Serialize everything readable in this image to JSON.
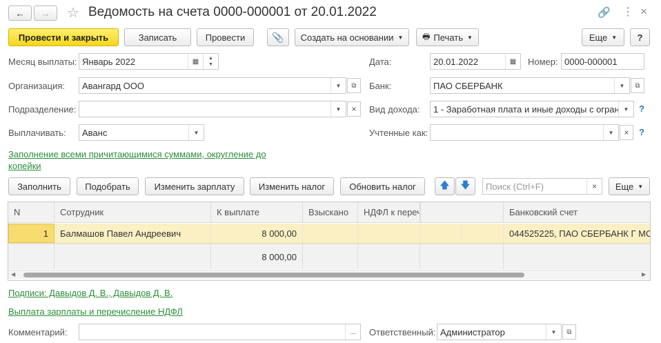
{
  "window": {
    "title": "Ведомость на счета 0000-000001 от 20.01.2022"
  },
  "toolbar": {
    "post_close": "Провести и закрыть",
    "save": "Записать",
    "post": "Провести",
    "create_based": "Создать на основании",
    "print": "Печать",
    "more": "Еще",
    "help": "?"
  },
  "form": {
    "month_label": "Месяц выплаты:",
    "month_value": "Январь 2022",
    "date_label": "Дата:",
    "date_value": "20.01.2022",
    "number_label": "Номер:",
    "number_value": "0000-000001",
    "org_label": "Организация:",
    "org_value": "Авангард ООО",
    "bank_label": "Банк:",
    "bank_value": "ПАО СБЕРБАНК",
    "dept_label": "Подразделение:",
    "dept_value": "",
    "income_label": "Вид дохода:",
    "income_value": "1 - Заработная плата и иные доходы с огран",
    "pay_label": "Выплачивать:",
    "pay_value": "Аванс",
    "counted_label": "Учтенные как:",
    "counted_value": "",
    "fill_link_line1": "Заполнение всеми причитающимися суммами, округление до",
    "fill_link_line2": "копейки"
  },
  "table_toolbar": {
    "fill": "Заполнить",
    "select": "Подобрать",
    "change_salary": "Изменить зарплату",
    "change_tax": "Изменить налог",
    "update_tax": "Обновить налог",
    "search_placeholder": "Поиск (Ctrl+F)",
    "more": "Еще"
  },
  "table": {
    "columns": [
      "N",
      "Сотрудник",
      "К выплате",
      "Взыскано",
      "НДФЛ к перечи...",
      "Банковский счет"
    ],
    "rows": [
      {
        "n": "1",
        "employee": "Балмашов Павел Андреевич",
        "amount": "8 000,00",
        "collected": "",
        "ndfl": "",
        "account": "044525225, ПАО СБЕРБАНК Г МО"
      }
    ],
    "total": "8 000,00"
  },
  "footer": {
    "signatures_link": "Подписи: Давыдов Д. В., Давыдов Д. В.",
    "payment_link": "Выплата зарплаты и перечисление НДФЛ",
    "comment_label": "Комментарий:",
    "comment_value": "",
    "responsible_label": "Ответственный:",
    "responsible_value": "Администратор"
  }
}
